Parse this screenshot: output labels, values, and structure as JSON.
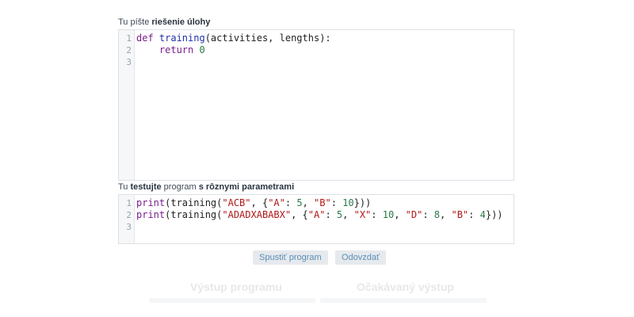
{
  "solution": {
    "label_prefix": "Tu píšte ",
    "label_bold": "riešenie úlohy",
    "lines": [
      {
        "num": "1",
        "tokens": [
          {
            "t": "def ",
            "c": "kw"
          },
          {
            "t": "training",
            "c": "fn"
          },
          {
            "t": "(activities, lengths):",
            "c": ""
          }
        ]
      },
      {
        "num": "2",
        "tokens": [
          {
            "t": "    ",
            "c": ""
          },
          {
            "t": "return ",
            "c": "kw"
          },
          {
            "t": "0",
            "c": "num"
          }
        ]
      },
      {
        "num": "3",
        "tokens": []
      }
    ]
  },
  "tests": {
    "label_prefix": "Tu ",
    "label_bold1": "testujte",
    "label_mid": " program ",
    "label_bold2": "s rôznymi parametrami",
    "lines": [
      {
        "num": "1",
        "tokens": [
          {
            "t": "print",
            "c": "kw"
          },
          {
            "t": "(training(",
            "c": ""
          },
          {
            "t": "\"ACB\"",
            "c": "str"
          },
          {
            "t": ", {",
            "c": ""
          },
          {
            "t": "\"A\"",
            "c": "str"
          },
          {
            "t": ": ",
            "c": ""
          },
          {
            "t": "5",
            "c": "num"
          },
          {
            "t": ", ",
            "c": ""
          },
          {
            "t": "\"B\"",
            "c": "str"
          },
          {
            "t": ": ",
            "c": ""
          },
          {
            "t": "10",
            "c": "num"
          },
          {
            "t": "}))",
            "c": ""
          }
        ]
      },
      {
        "num": "2",
        "tokens": [
          {
            "t": "print",
            "c": "kw"
          },
          {
            "t": "(training(",
            "c": ""
          },
          {
            "t": "\"ADADXABABX\"",
            "c": "str"
          },
          {
            "t": ", {",
            "c": ""
          },
          {
            "t": "\"A\"",
            "c": "str"
          },
          {
            "t": ": ",
            "c": ""
          },
          {
            "t": "5",
            "c": "num"
          },
          {
            "t": ", ",
            "c": ""
          },
          {
            "t": "\"X\"",
            "c": "str"
          },
          {
            "t": ": ",
            "c": ""
          },
          {
            "t": "10",
            "c": "num"
          },
          {
            "t": ", ",
            "c": ""
          },
          {
            "t": "\"D\"",
            "c": "str"
          },
          {
            "t": ": ",
            "c": ""
          },
          {
            "t": "8",
            "c": "num"
          },
          {
            "t": ", ",
            "c": ""
          },
          {
            "t": "\"B\"",
            "c": "str"
          },
          {
            "t": ": ",
            "c": ""
          },
          {
            "t": "4",
            "c": "num"
          },
          {
            "t": "}))",
            "c": ""
          }
        ]
      },
      {
        "num": "3",
        "tokens": []
      }
    ]
  },
  "buttons": {
    "run": "Spustiť program",
    "submit": "Odovzdať"
  },
  "output": {
    "program_heading": "Výstup programu",
    "expected_heading": "Očakávaný výstup"
  },
  "colors": {
    "keyword": "#7a1e8e",
    "function": "#1f2fa8",
    "string": "#b0181a",
    "number": "#2a7a48",
    "button_text": "#5a8fb6"
  }
}
